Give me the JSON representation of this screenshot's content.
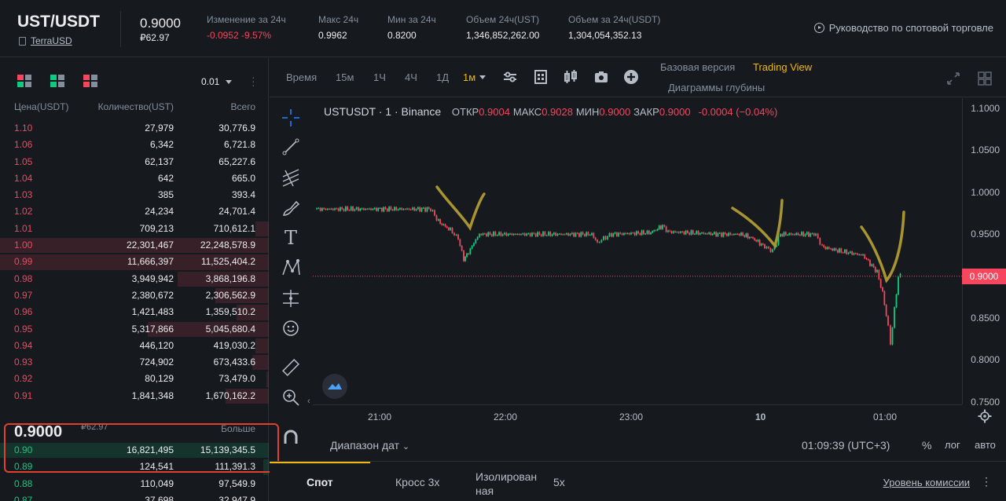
{
  "header": {
    "pair": "UST/USDT",
    "sub_link": "TerraUSD",
    "last_price": "0.9000",
    "last_price_rub": "₽62.97",
    "stats": [
      {
        "label": "Изменение за 24ч",
        "value": "-0.0952 -9.57%",
        "negative": true
      },
      {
        "label": "Макс 24ч",
        "value": "0.9962"
      },
      {
        "label": "Мин за 24ч",
        "value": "0.8200"
      },
      {
        "label": "Объем 24ч(UST)",
        "value": "1,346,852,262.00"
      },
      {
        "label": "Объем за 24ч(USDT)",
        "value": "1,304,054,352.13"
      }
    ],
    "guide": "Руководство по спотовой торговле"
  },
  "orderbook": {
    "precision": "0.01",
    "columns": {
      "price": "Цена(USDT)",
      "qty": "Количество(UST)",
      "total": "Всего"
    },
    "asks": [
      {
        "price": "1.10",
        "qty": "27,979",
        "total": "30,776.9",
        "depth": 0.0
      },
      {
        "price": "1.06",
        "qty": "6,342",
        "total": "6,721.8",
        "depth": 0.0
      },
      {
        "price": "1.05",
        "qty": "62,137",
        "total": "65,227.6",
        "depth": 0.0
      },
      {
        "price": "1.04",
        "qty": "642",
        "total": "665.0",
        "depth": 0.0
      },
      {
        "price": "1.03",
        "qty": "385",
        "total": "393.4",
        "depth": 0.0
      },
      {
        "price": "1.02",
        "qty": "24,234",
        "total": "24,701.4",
        "depth": 0.0
      },
      {
        "price": "1.01",
        "qty": "709,213",
        "total": "710,612.1",
        "depth": 0.05
      },
      {
        "price": "1.00",
        "qty": "22,301,467",
        "total": "22,248,578.9",
        "depth": 1.0
      },
      {
        "price": "0.99",
        "qty": "11,666,397",
        "total": "11,525,404.2",
        "depth": 1.0
      },
      {
        "price": "0.98",
        "qty": "3,949,942",
        "total": "3,868,196.8",
        "depth": 0.34
      },
      {
        "price": "0.97",
        "qty": "2,380,672",
        "total": "2,306,562.9",
        "depth": 0.2
      },
      {
        "price": "0.96",
        "qty": "1,421,483",
        "total": "1,359,510.2",
        "depth": 0.12
      },
      {
        "price": "0.95",
        "qty": "5,317,866",
        "total": "5,045,680.4",
        "depth": 0.45
      },
      {
        "price": "0.94",
        "qty": "446,120",
        "total": "419,030.2",
        "depth": 0.05
      },
      {
        "price": "0.93",
        "qty": "724,902",
        "total": "673,433.6",
        "depth": 0.06
      },
      {
        "price": "0.92",
        "qty": "80,129",
        "total": "73,479.0",
        "depth": 0.01
      },
      {
        "price": "0.91",
        "qty": "1,841,348",
        "total": "1,670,162.2",
        "depth": 0.16
      }
    ],
    "mid_price": "0.9000",
    "mid_rub": "₽62.97",
    "more": "Больше",
    "bids": [
      {
        "price": "0.90",
        "qty": "16,821,495",
        "total": "15,139,345.5",
        "depth": 1.0
      },
      {
        "price": "0.89",
        "qty": "124,541",
        "total": "111,391.3",
        "depth": 0.02
      },
      {
        "price": "0.88",
        "qty": "110,049",
        "total": "97,549.9",
        "depth": 0.0
      },
      {
        "price": "0.87",
        "qty": "37,698",
        "total": "32,947.9",
        "depth": 0.0
      }
    ]
  },
  "toolbar": {
    "time_label": "Время",
    "timeframes": [
      "15м",
      "1Ч",
      "4Ч",
      "1Д",
      "1м"
    ],
    "active_tf": "1м",
    "version_basic": "Базовая версия",
    "version_tv": "Trading View",
    "depth_charts": "Диаграммы глубины"
  },
  "chart": {
    "symbol": "USTUSDT · 1 · Binance",
    "o_label": "ОТКР",
    "o": "0.9004",
    "h_label": "МАКС",
    "h": "0.9028",
    "l_label": "МИН",
    "l": "0.9000",
    "c_label": "ЗАКР",
    "c": "0.9000",
    "change": "-0.0004 (−0.04%)",
    "y_ticks": [
      "1.1000",
      "1.0500",
      "1.0000",
      "0.9500",
      "0.9000",
      "0.8500",
      "0.8000",
      "0.7500"
    ],
    "x_ticks": [
      "21:00",
      "22:00",
      "23:00",
      "10",
      "01:00"
    ],
    "current": "0.9000",
    "range_label": "Диапазон дат",
    "clock": "01:09:39 (UTC+3)",
    "pct": "%",
    "log": "лог",
    "auto": "авто",
    "colors": {
      "up": "#0ecb81",
      "down": "#f6465d",
      "annotation": "#a89431"
    }
  },
  "chart_data": {
    "type": "line",
    "x": [
      "20:25",
      "21:00",
      "21:30",
      "21:50",
      "22:00",
      "22:30",
      "23:00",
      "23:20",
      "23:45",
      "00:00",
      "00:15",
      "00:30",
      "00:45",
      "00:59",
      "01:05",
      "01:09"
    ],
    "series": [
      {
        "values": [
          0.98,
          0.98,
          0.98,
          0.92,
          0.95,
          0.95,
          0.95,
          0.955,
          0.95,
          0.95,
          0.935,
          0.95,
          0.95,
          0.93,
          0.82,
          0.9
        ]
      }
    ],
    "ylim": [
      0.75,
      1.1
    ]
  },
  "bottom": {
    "tabs": [
      "Спот",
      "Кросс 3x",
      "Изолирован ная",
      "5x"
    ],
    "fee_link": "Уровень комиссии"
  }
}
